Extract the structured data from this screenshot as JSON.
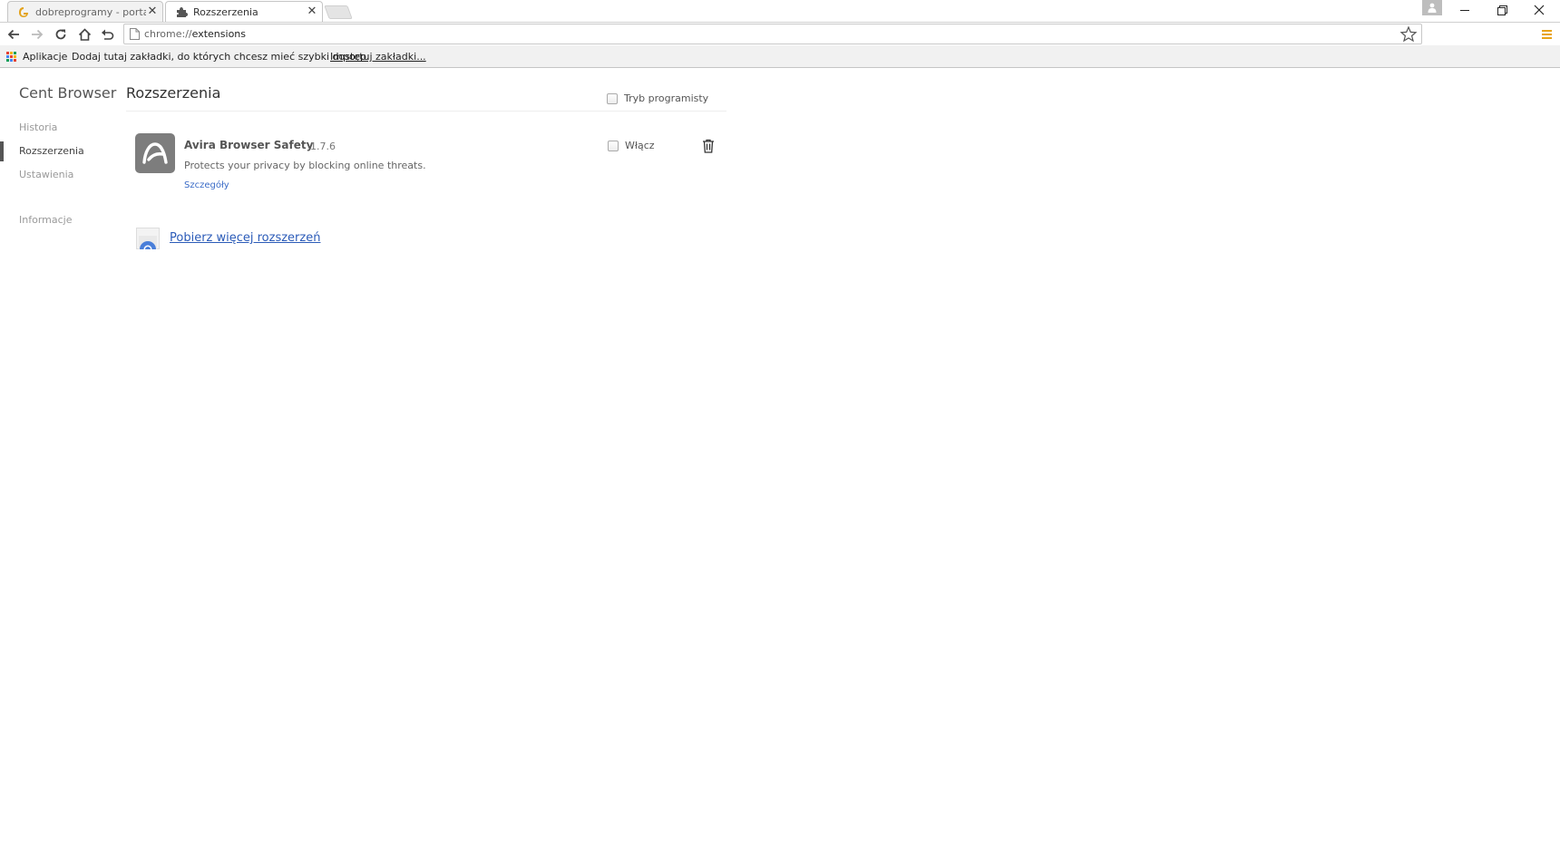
{
  "tabs": [
    {
      "title": "dobreprogramy - portal n",
      "active": false
    },
    {
      "title": "Rozszerzenia",
      "active": true
    }
  ],
  "omnibox": {
    "scheme": "chrome://",
    "path": "extensions"
  },
  "bookmarks": {
    "apps_label": "Aplikacje",
    "hint": "Dodaj tutaj zakładki, do których chcesz mieć szybki dostęp.",
    "import_label": "Importuj zakładki..."
  },
  "sidebar": {
    "brand": "Cent Browser",
    "items": [
      {
        "label": "Historia"
      },
      {
        "label": "Rozszerzenia",
        "selected": true
      },
      {
        "label": "Ustawienia"
      },
      {
        "label": "Informacje"
      }
    ]
  },
  "main": {
    "title": "Rozszerzenia",
    "developer_mode_label": "Tryb programisty",
    "extension": {
      "name": "Avira Browser Safety",
      "version": "1.7.6",
      "description": "Protects your privacy by blocking online threats.",
      "details_label": "Szczegóły",
      "enable_label": "Włącz"
    },
    "get_more_label": "Pobierz więcej rozszerzeń"
  },
  "colors": {
    "link": "#2b5bb8",
    "menu_accent": "#e8a317"
  }
}
